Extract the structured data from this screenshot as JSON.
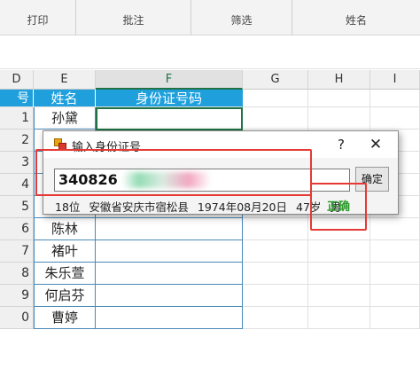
{
  "ribbon": {
    "groups": [
      "打印",
      "批注",
      "筛选",
      "姓名"
    ]
  },
  "columns": {
    "headers": [
      "D",
      "E",
      "F",
      "G",
      "H",
      "I"
    ]
  },
  "table": {
    "col_d_header": "号",
    "col_e_header": "姓名",
    "col_f_header": "身份证号码",
    "rows": [
      {
        "num": "1",
        "name": "孙黛"
      },
      {
        "num": "2",
        "name": ""
      },
      {
        "num": "3",
        "name": ""
      },
      {
        "num": "4",
        "name": ""
      },
      {
        "num": "5",
        "name": ""
      },
      {
        "num": "6",
        "name": "陈林"
      },
      {
        "num": "7",
        "name": "褚叶"
      },
      {
        "num": "8",
        "name": "朱乐萱"
      },
      {
        "num": "9",
        "name": "何启芬"
      },
      {
        "num": "0",
        "name": "曹婷"
      }
    ]
  },
  "dialog": {
    "title": "输入身份证号",
    "help": "?",
    "close": "✕",
    "input_value": "340826",
    "input_tail": "",
    "ok_label": "确定",
    "info": {
      "length": "18位",
      "region": "安徽省安庆市宿松县",
      "birthdate": "1974年08月20日",
      "age": "47岁",
      "gender": "男"
    },
    "status": "正确"
  },
  "colors": {
    "header_blue": "#1fa0dd",
    "highlight_red": "#e53935",
    "valid_green": "#2a9b2a",
    "excel_green": "#217346"
  }
}
